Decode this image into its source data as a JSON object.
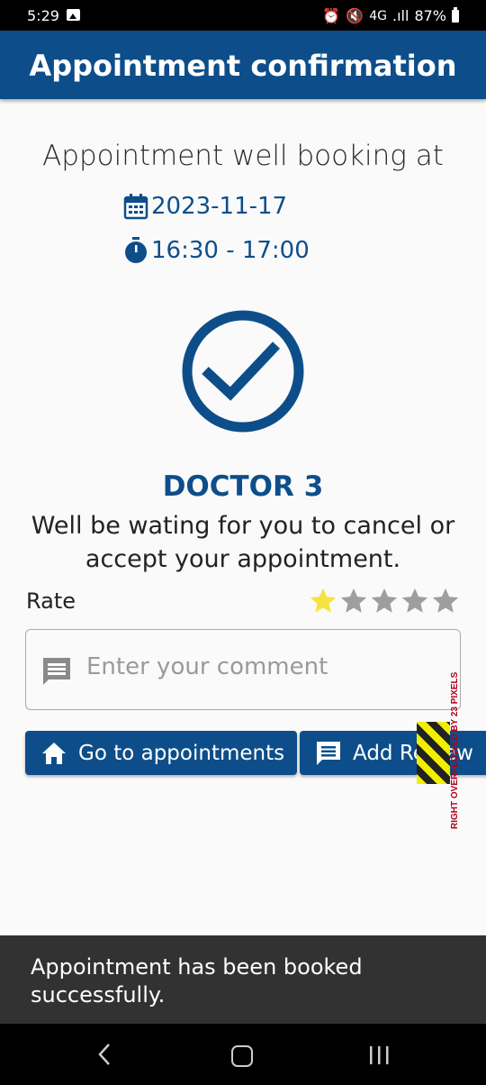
{
  "status_bar": {
    "time": "5:29",
    "network": "4G",
    "battery": "87%"
  },
  "app_bar": {
    "title": "Appointment confirmation"
  },
  "appointment": {
    "heading": "Appointment well booking at",
    "date": "2023-11-17",
    "time": "16:30 - 17:00",
    "doctor": "DOCTOR 3",
    "message": "Well be wating for you to cancel or accept your appointment."
  },
  "rating": {
    "label": "Rate",
    "value": 1,
    "max": 5,
    "filled_color": "#f5e342",
    "empty_color": "#9e9e9e"
  },
  "comment": {
    "placeholder": "Enter your comment"
  },
  "buttons": {
    "go_to_appointments": "Go to appointments",
    "add_review": "Add Review"
  },
  "overflow_warning": "RIGHT OVERFLOWED BY 23 PIXELS",
  "snackbar": {
    "message": "Appointment has been booked successfully."
  },
  "colors": {
    "primary": "#0d4e8a",
    "snackbar": "#323232"
  }
}
